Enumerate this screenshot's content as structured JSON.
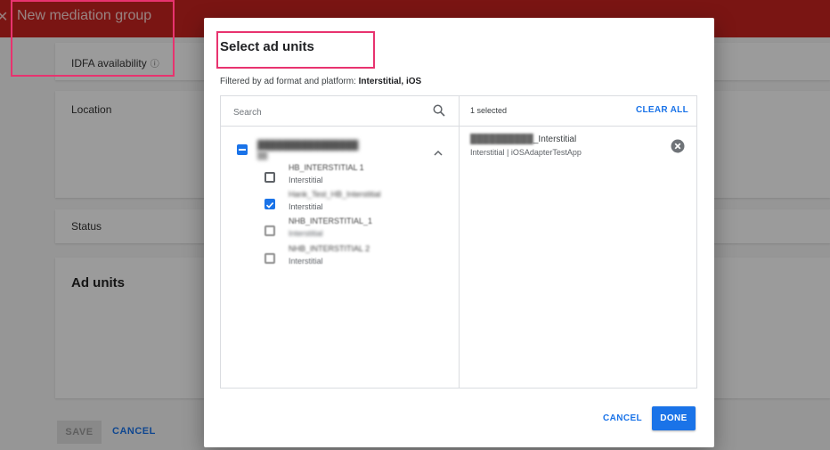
{
  "background": {
    "title": "New mediation group",
    "cards": {
      "idfa_label": "IDFA availability",
      "location_label": "Location",
      "status_label": "Status",
      "ad_units_heading": "Ad units"
    },
    "save_label": "SAVE",
    "cancel_label": "CANCEL"
  },
  "dialog": {
    "title": "Select ad units",
    "filter_prefix": "Filtered by ad format and platform: ",
    "filter_value": "Interstitial, iOS",
    "search": {
      "placeholder": "Search"
    },
    "units": [
      {
        "name": "HB_INTERSTITIAL 1",
        "format": "Interstitial",
        "state": "unchecked"
      },
      {
        "name": "Hank_Test_HB_Interstitial",
        "format": "Interstitial",
        "state": "checked"
      },
      {
        "name": "NHB_INTERSTITIAL_1",
        "format": "Interstitial",
        "state": "disabled"
      },
      {
        "name": "NHB_INTERSTITIAL 2",
        "format": "Interstitial",
        "state": "disabled"
      }
    ],
    "selected": {
      "count_label": "1 selected",
      "clear_all_label": "CLEAR ALL",
      "item_name_suffix": "_Interstitial",
      "item_detail": "Interstitial | iOSAdapterTestApp"
    },
    "cancel_label": "CANCEL",
    "done_label": "DONE"
  },
  "colors": {
    "header_red": "#c5221f",
    "primary_blue": "#1a73e8",
    "annotation_pink": "#e8336f"
  }
}
